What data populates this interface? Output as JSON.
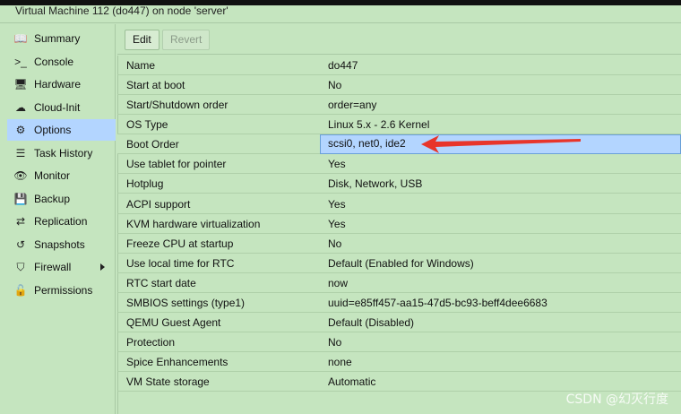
{
  "window": {
    "title": "Virtual Machine 112 (do447) on node 'server'"
  },
  "sidebar": {
    "items": [
      {
        "label": "Summary",
        "icon": "book-icon",
        "glyph": "📖"
      },
      {
        "label": "Console",
        "icon": "terminal-icon",
        "glyph": ">_"
      },
      {
        "label": "Hardware",
        "icon": "monitor-icon",
        "glyph": "🖥"
      },
      {
        "label": "Cloud-Init",
        "icon": "cloud-icon",
        "glyph": "☁"
      },
      {
        "label": "Options",
        "icon": "gear-icon",
        "glyph": "⚙"
      },
      {
        "label": "Task History",
        "icon": "list-icon",
        "glyph": "☰"
      },
      {
        "label": "Monitor",
        "icon": "eye-icon",
        "glyph": "👁"
      },
      {
        "label": "Backup",
        "icon": "floppy-icon",
        "glyph": "💾"
      },
      {
        "label": "Replication",
        "icon": "retweet-icon",
        "glyph": "⇄"
      },
      {
        "label": "Snapshots",
        "icon": "history-icon",
        "glyph": "↺"
      },
      {
        "label": "Firewall",
        "icon": "shield-icon",
        "glyph": "⛉"
      },
      {
        "label": "Permissions",
        "icon": "unlock-icon",
        "glyph": "🔓"
      }
    ],
    "active": "Options"
  },
  "toolbar": {
    "edit_label": "Edit",
    "revert_label": "Revert"
  },
  "options": [
    {
      "name": "Name",
      "value": "do447"
    },
    {
      "name": "Start at boot",
      "value": "No"
    },
    {
      "name": "Start/Shutdown order",
      "value": "order=any"
    },
    {
      "name": "OS Type",
      "value": "Linux 5.x - 2.6 Kernel"
    },
    {
      "name": "Boot Order",
      "value": "scsi0, net0, ide2"
    },
    {
      "name": "Use tablet for pointer",
      "value": "Yes"
    },
    {
      "name": "Hotplug",
      "value": "Disk, Network, USB"
    },
    {
      "name": "ACPI support",
      "value": "Yes"
    },
    {
      "name": "KVM hardware virtualization",
      "value": "Yes"
    },
    {
      "name": "Freeze CPU at startup",
      "value": "No"
    },
    {
      "name": "Use local time for RTC",
      "value": "Default (Enabled for Windows)"
    },
    {
      "name": "RTC start date",
      "value": "now"
    },
    {
      "name": "SMBIOS settings (type1)",
      "value": "uuid=e85ff457-aa15-47d5-bc93-beff4dee6683"
    },
    {
      "name": "QEMU Guest Agent",
      "value": "Default (Disabled)"
    },
    {
      "name": "Protection",
      "value": "No"
    },
    {
      "name": "Spice Enhancements",
      "value": "none"
    },
    {
      "name": "VM State storage",
      "value": "Automatic"
    }
  ],
  "selected_row": "Boot Order",
  "watermark": "CSDN @幻灭行度",
  "colors": {
    "background": "#c5e5bf",
    "selection": "#b3d5ff",
    "annotation_arrow": "#e8352b"
  }
}
